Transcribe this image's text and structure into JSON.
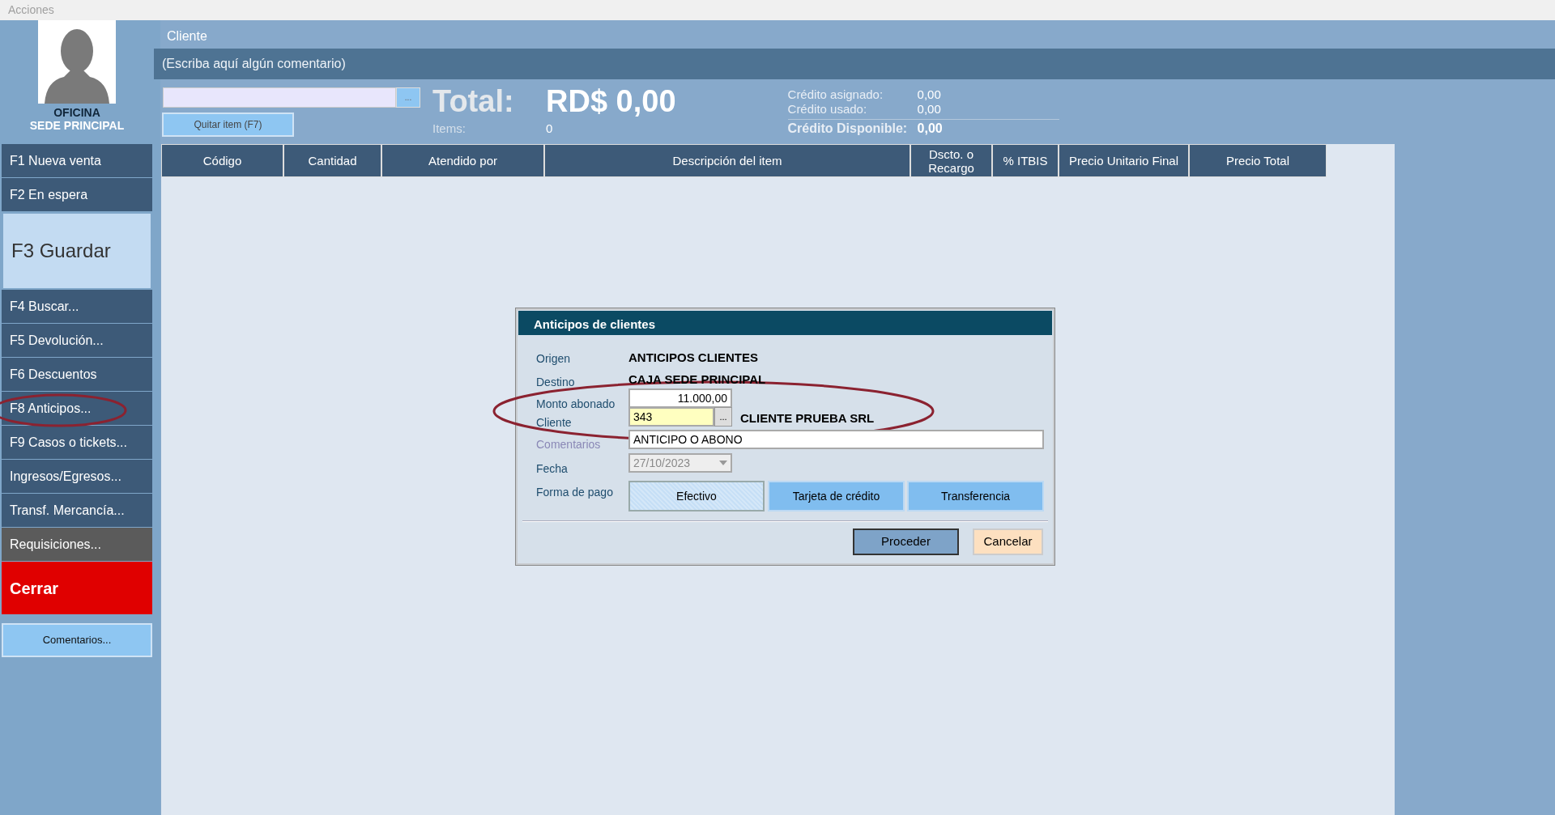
{
  "menu_bar": {
    "title": "Acciones"
  },
  "sidebar": {
    "office": "OFICINA",
    "branch": "SEDE PRINCIPAL",
    "items": [
      {
        "label": "F1 Nueva venta",
        "kind": "normal"
      },
      {
        "label": "F2 En espera",
        "kind": "normal"
      },
      {
        "label": "F3 Guardar",
        "kind": "large"
      },
      {
        "label": "F4 Buscar...",
        "kind": "normal"
      },
      {
        "label": "F5 Devolución...",
        "kind": "normal"
      },
      {
        "label": "F6 Descuentos",
        "kind": "normal"
      },
      {
        "label": "F8 Anticipos...",
        "kind": "normal"
      },
      {
        "label": "F9 Casos o tickets...",
        "kind": "normal"
      },
      {
        "label": "Ingresos/Egresos...",
        "kind": "normal"
      },
      {
        "label": "Transf. Mercancía...",
        "kind": "normal"
      },
      {
        "label": "Requisiciones...",
        "kind": "muted"
      },
      {
        "label": "Cerrar",
        "kind": "danger"
      }
    ],
    "comments_button": "Comentarios..."
  },
  "header": {
    "client_label": "Cliente",
    "comment_placeholder": "(Escriba aquí algún comentario)",
    "lookup_button": "...",
    "remove_button": "Quitar item (F7)",
    "total_label": "Total:",
    "total_value": "RD$ 0,00",
    "items_label": "Items:",
    "items_value": "0",
    "credit": [
      {
        "label": "Crédito asignado:",
        "value": "0,00",
        "kind": "normal"
      },
      {
        "label": "Crédito usado:",
        "value": "0,00",
        "kind": "normal"
      },
      {
        "label": "Crédito Disponible:",
        "value": "0,00",
        "kind": "bold"
      }
    ]
  },
  "table": {
    "columns": [
      "Código",
      "Cantidad",
      "Atendido por",
      "Descripción del item",
      "Dscto. o Recargo",
      "% ITBIS",
      "Precio Unitario Final",
      "Precio Total"
    ]
  },
  "dialog": {
    "title": "Anticipos de clientes",
    "origin_label": "Origen",
    "origin_value": "ANTICIPOS CLIENTES",
    "destination_label": "Destino",
    "destination_value": "CAJA SEDE PRINCIPAL",
    "amount_label": "Monto abonado",
    "amount_value": "11.000,00",
    "client_label": "Cliente",
    "client_code": "343",
    "client_lookup": "...",
    "client_name": "CLIENTE PRUEBA SRL",
    "comments_label": "Comentarios",
    "comments_value": "ANTICIPO O ABONO",
    "date_label": "Fecha",
    "date_value": "27/10/2023",
    "date_disabled": true,
    "payment_label": "Forma de pago",
    "payment_options": [
      {
        "label": "Efectivo",
        "selected": true
      },
      {
        "label": "Tarjeta de crédito",
        "selected": false
      },
      {
        "label": "Transferencia",
        "selected": false
      }
    ],
    "buttons": [
      {
        "label": "Proceder",
        "kind": "primary"
      },
      {
        "label": "Cancelar",
        "kind": "cancel"
      }
    ]
  }
}
